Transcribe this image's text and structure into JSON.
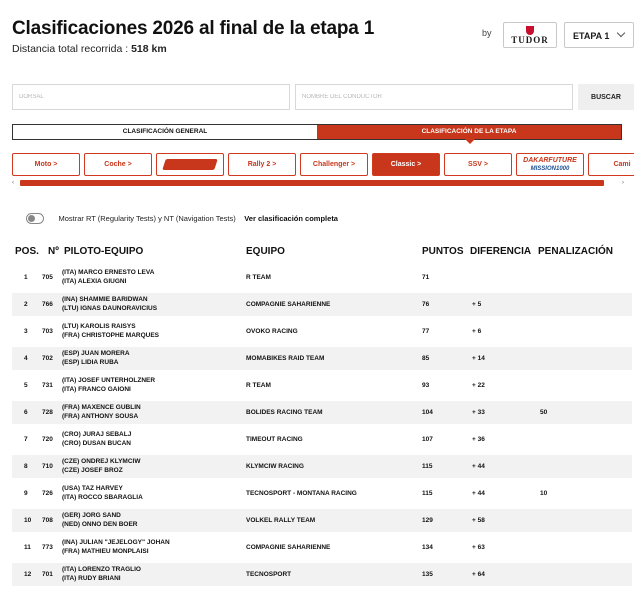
{
  "header": {
    "title": "Clasificaciones 2026 al final de la etapa 1",
    "distance_label": "Distancia total recorrida :",
    "distance_value": "518 km",
    "by_label": "by",
    "sponsor": "TUDOR",
    "etapa_select": "ETAPA 1"
  },
  "search": {
    "dorsal_placeholder": "DORSAL",
    "nombre_placeholder": "NOMBRE DEL CONDUCTOR",
    "buscar_label": "BUSCAR"
  },
  "tabs": {
    "general": "CLASIFICACIÓN GENERAL",
    "etapa": "CLASIFICACIÓN DE LA ETAPA"
  },
  "categories": [
    {
      "label": "Moto >",
      "active": false
    },
    {
      "label": "Coche >",
      "active": false
    },
    {
      "label": "",
      "logo": "stock-logo",
      "active": false
    },
    {
      "label": "Rally 2 >",
      "active": false
    },
    {
      "label": "Challenger >",
      "active": false
    },
    {
      "label": "Classic >",
      "active": true
    },
    {
      "label": "SSV >",
      "active": false
    },
    {
      "label": "DAKARFUTURE",
      "sub": "MISSION1000",
      "active": false
    },
    {
      "label": "Cami",
      "active": false
    }
  ],
  "toggle": {
    "label": "Mostrar RT (Regularity Tests) y NT (Navigation Tests)",
    "link": "Ver clasificación completa"
  },
  "table": {
    "headers": {
      "pos": "POS.",
      "num": "Nº",
      "piloto": "PILOTO-EQUIPO",
      "equipo": "EQUIPO",
      "puntos": "PUNTOS",
      "diferencia": "DIFERENCIA",
      "penalizacion": "PENALIZACIÓN"
    },
    "rows": [
      {
        "pos": "1",
        "num": "705",
        "d1": "(ITA)  MARCO ERNESTO LEVA",
        "d2": "(ITA)  ALEXIA GIUGNI",
        "equipo": "R TEAM",
        "puntos": "71",
        "dif": "",
        "pen": ""
      },
      {
        "pos": "2",
        "num": "766",
        "d1": "(INA)  SHAMMIE BARIDWAN",
        "d2": "(LTU)  IGNAS DAUNORAVICIUS",
        "equipo": "COMPAGNIE SAHARIENNE",
        "puntos": "76",
        "dif": "+ 5",
        "pen": ""
      },
      {
        "pos": "3",
        "num": "703",
        "d1": "(LTU)  KAROLIS RAISYS",
        "d2": "(FRA)  CHRISTOPHE MARQUES",
        "equipo": "OVOKO RACING",
        "puntos": "77",
        "dif": "+ 6",
        "pen": ""
      },
      {
        "pos": "4",
        "num": "702",
        "d1": "(ESP)  JUAN MORERA",
        "d2": "(ESP)  LIDIA RUBA",
        "equipo": "MOMABIKES RAID TEAM",
        "puntos": "85",
        "dif": "+ 14",
        "pen": ""
      },
      {
        "pos": "5",
        "num": "731",
        "d1": "(ITA)  JOSEF UNTERHOLZNER",
        "d2": "(ITA)  FRANCO GAIONI",
        "equipo": "R TEAM",
        "puntos": "93",
        "dif": "+ 22",
        "pen": ""
      },
      {
        "pos": "6",
        "num": "728",
        "d1": "(FRA)  MAXENCE GUBLIN",
        "d2": "(FRA)  ANTHONY SOUSA",
        "equipo": "BOLIDES RACING TEAM",
        "puntos": "104",
        "dif": "+ 33",
        "pen": "50"
      },
      {
        "pos": "7",
        "num": "720",
        "d1": "(CRO)  JURAJ SEBALJ",
        "d2": "(CRO)  DUSAN BUCAN",
        "equipo": "TIMEOUT RACING",
        "puntos": "107",
        "dif": "+ 36",
        "pen": ""
      },
      {
        "pos": "8",
        "num": "710",
        "d1": "(CZE)  ONDREJ KLYMCIW",
        "d2": "(CZE)  JOSEF BROZ",
        "equipo": "KLYMCIW RACING",
        "puntos": "115",
        "dif": "+ 44",
        "pen": ""
      },
      {
        "pos": "9",
        "num": "726",
        "d1": "(USA)  TAZ HARVEY",
        "d2": "(ITA)  ROCCO SBARAGLIA",
        "equipo": "TECNOSPORT - MONTANA RACING",
        "puntos": "115",
        "dif": "+ 44",
        "pen": "10"
      },
      {
        "pos": "10",
        "num": "708",
        "d1": "(GER)  JORG SAND",
        "d2": "(NED)  ONNO DEN BOER",
        "equipo": "VOLKEL RALLY TEAM",
        "puntos": "129",
        "dif": "+ 58",
        "pen": ""
      },
      {
        "pos": "11",
        "num": "773",
        "d1": "(INA)  JULIAN \"JEJELOGY\" JOHAN",
        "d2": "(FRA)  MATHIEU MONPLAISI",
        "equipo": "COMPAGNIE SAHARIENNE",
        "puntos": "134",
        "dif": "+ 63",
        "pen": ""
      },
      {
        "pos": "12",
        "num": "701",
        "d1": "(ITA)  LORENZO TRAGLIO",
        "d2": "(ITA)  RUDY BRIANI",
        "equipo": "TECNOSPORT",
        "puntos": "135",
        "dif": "+ 64",
        "pen": ""
      }
    ]
  },
  "colors": {
    "accent": "#c8361b",
    "row_alt": "#f2f2f2"
  }
}
